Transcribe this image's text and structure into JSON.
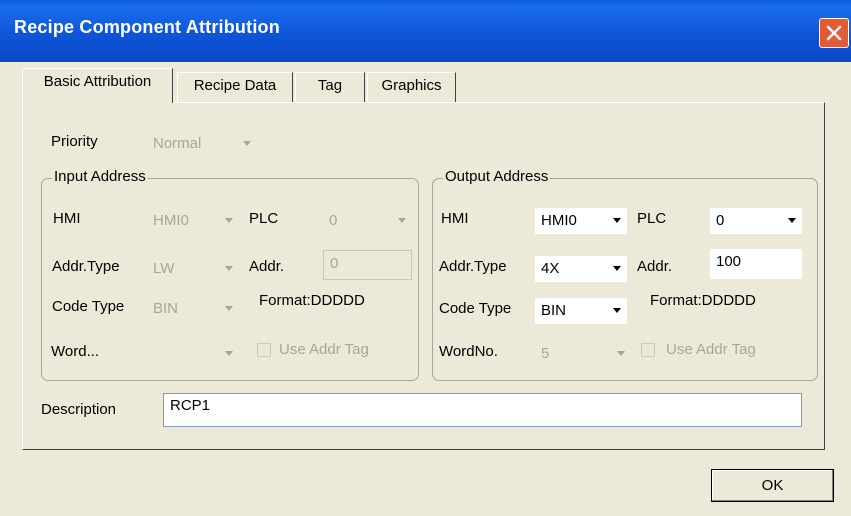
{
  "window": {
    "title": "Recipe Component Attribution"
  },
  "tabs": [
    {
      "label": "Basic Attribution"
    },
    {
      "label": "Recipe Data"
    },
    {
      "label": "Tag"
    },
    {
      "label": "Graphics"
    }
  ],
  "basic": {
    "priority_label": "Priority",
    "priority_value": "Normal",
    "input_address": {
      "title": "Input Address",
      "hmi_label": "HMI",
      "hmi_value": "HMI0",
      "plc_label": "PLC",
      "plc_value": "0",
      "addr_type_label": "Addr.Type",
      "addr_type_value": "LW",
      "addr_label": "Addr.",
      "addr_value": "0",
      "code_type_label": "Code Type",
      "code_type_value": "BIN",
      "format_label": "Format:DDDDD",
      "word_label": "Word...",
      "word_value": "",
      "use_addr_tag_label": "Use Addr Tag"
    },
    "output_address": {
      "title": "Output Address",
      "hmi_label": "HMI",
      "hmi_value": "HMI0",
      "plc_label": "PLC",
      "plc_value": "0",
      "addr_type_label": "Addr.Type",
      "addr_type_value": "4X",
      "addr_label": "Addr.",
      "addr_value": "100",
      "code_type_label": "Code Type",
      "code_type_value": "BIN",
      "format_label": "Format:DDDDD",
      "word_label": "WordNo.",
      "word_value": "5",
      "use_addr_tag_label": "Use Addr Tag"
    },
    "description_label": "Description",
    "description_value": "RCP1"
  },
  "footer": {
    "ok_label": "OK"
  }
}
